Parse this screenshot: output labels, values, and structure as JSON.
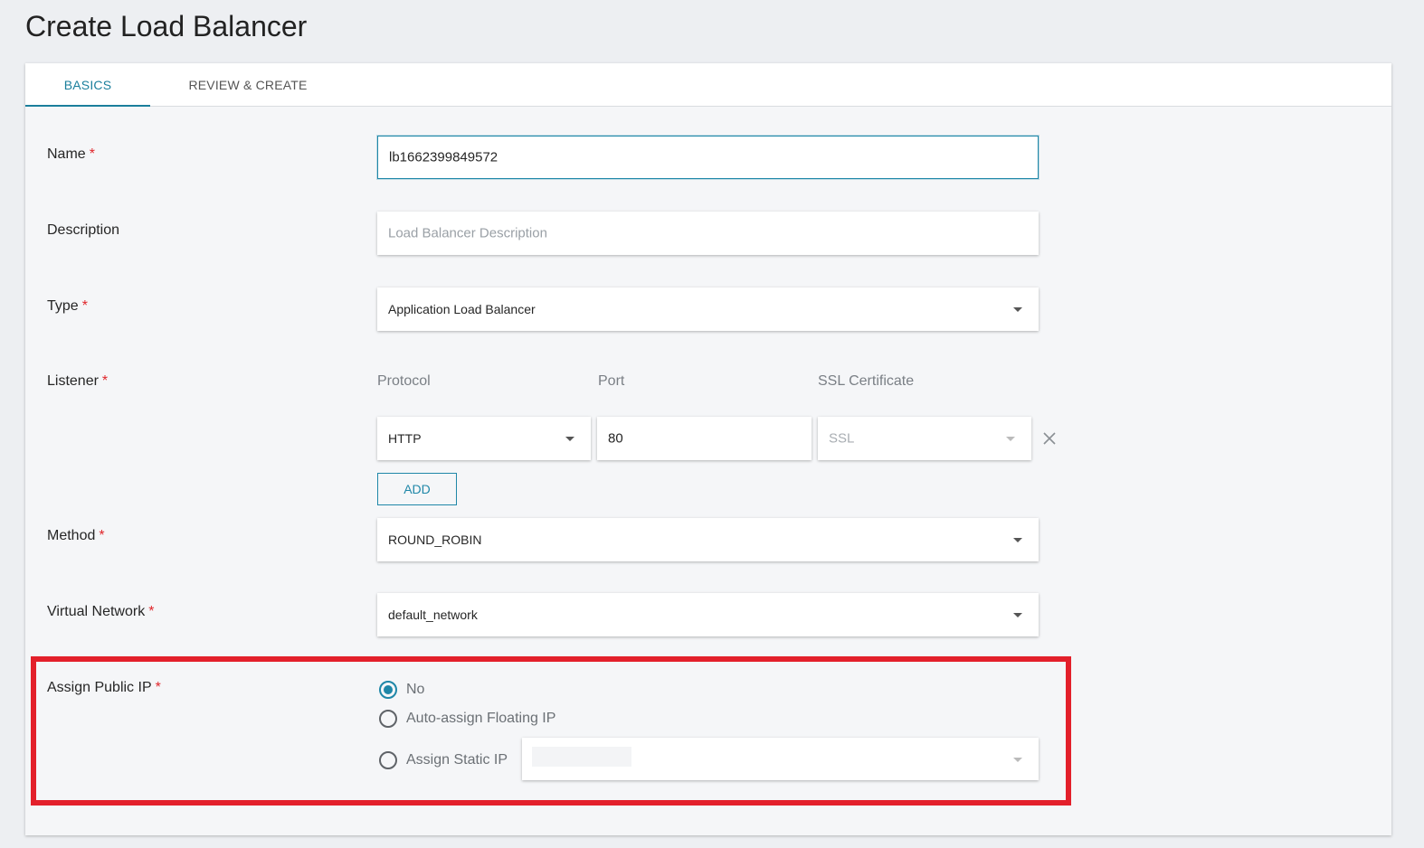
{
  "page": {
    "title": "Create Load Balancer"
  },
  "tabs": [
    {
      "label": "BASICS",
      "active": true
    },
    {
      "label": "REVIEW & CREATE",
      "active": false
    }
  ],
  "required_marker": "*",
  "form": {
    "name": {
      "label": "Name",
      "value": "lb1662399849572"
    },
    "description": {
      "label": "Description",
      "placeholder": "Load Balancer Description",
      "value": ""
    },
    "type": {
      "label": "Type",
      "value": "Application Load Balancer"
    },
    "listener": {
      "label": "Listener",
      "columns": {
        "protocol": "Protocol",
        "port": "Port",
        "ssl": "SSL Certificate"
      },
      "protocol": "HTTP",
      "port": "80",
      "ssl_placeholder": "SSL",
      "add_label": "ADD"
    },
    "method": {
      "label": "Method",
      "value": "ROUND_ROBIN"
    },
    "network": {
      "label": "Virtual Network",
      "value": "default_network"
    },
    "public_ip": {
      "label": "Assign Public IP",
      "options": [
        {
          "label": "No",
          "checked": true
        },
        {
          "label": "Auto-assign Floating IP",
          "checked": false
        },
        {
          "label": "Assign Static IP",
          "checked": false
        }
      ],
      "static_ip_value": ""
    }
  },
  "colors": {
    "accent": "#1f87a8",
    "required": "#e0262b",
    "highlight": "#e3202b"
  },
  "icons": {
    "dropdown": "chevron-down-icon",
    "remove": "close-icon"
  }
}
